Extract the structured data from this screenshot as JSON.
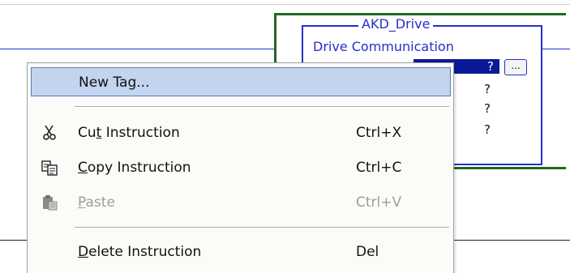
{
  "block": {
    "title": "AKD_Drive",
    "subtitle": "Drive Communication",
    "operand_values": [
      "?",
      "?",
      "?",
      "?"
    ],
    "browse_button_label": "..."
  },
  "context_menu": {
    "items": [
      {
        "label": "New Tag...",
        "shortcut": "",
        "icon": "",
        "enabled": true,
        "highlighted": true
      },
      {
        "label_pre": "Cu",
        "label_mnemonic": "t",
        "label_post": " Instruction",
        "shortcut": "Ctrl+X",
        "icon": "scissors-icon",
        "enabled": true
      },
      {
        "label_pre": "",
        "label_mnemonic": "C",
        "label_post": "opy Instruction",
        "shortcut": "Ctrl+C",
        "icon": "copy-icon",
        "enabled": true
      },
      {
        "label_pre": "",
        "label_mnemonic": "P",
        "label_post": "aste",
        "shortcut": "Ctrl+V",
        "icon": "paste-icon",
        "enabled": false
      },
      {
        "label_pre": "",
        "label_mnemonic": "D",
        "label_post": "elete Instruction",
        "shortcut": "Del",
        "icon": "",
        "enabled": true
      }
    ]
  },
  "colors": {
    "rung_blue": "#1f2fd1",
    "block_green": "#1f6a1f",
    "selection_navy": "#0a1a96",
    "menu_highlight": "#c2d4ee"
  }
}
